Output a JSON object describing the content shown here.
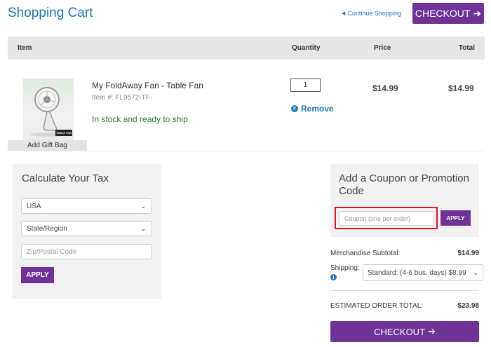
{
  "header": {
    "title": "Shopping Cart",
    "continue_label": "Continue Shopping",
    "checkout_label": "CHECKOUT"
  },
  "table": {
    "columns": [
      "Item",
      "Quantity",
      "Price",
      "Total"
    ]
  },
  "cart_item": {
    "name": "My FoldAway Fan - Table Fan",
    "item_number": "Item #: FL9572-TF",
    "stock_status": "In stock and ready to ship",
    "image_tag": "TABLE FAN",
    "gift_bag_label": "Add Gift Bag",
    "quantity": "1",
    "remove_label": "Remove",
    "price": "$14.99",
    "total": "$14.99"
  },
  "tax": {
    "title": "Calculate Your Tax",
    "country": "USA",
    "region": "State/Region",
    "zip_placeholder": "Zip/Postal Code",
    "apply_label": "APPLY"
  },
  "coupon": {
    "title": "Add a Coupon or Promotion Code",
    "placeholder": "Coupon (one per order)",
    "apply_label": "APPLY"
  },
  "summary": {
    "subtotal_label": "Merchandise Subtotal:",
    "subtotal_value": "$14.99",
    "shipping_label": "Shipping:",
    "shipping_option": "Standard: (4-6 bus. days) $8.99",
    "estimated_label": "ESTIMATED ORDER TOTAL:",
    "estimated_value": "$23.98",
    "checkout_label": "CHECKOUT"
  },
  "colors": {
    "brand_blue": "#1f76b8",
    "brand_purple": "#6f3398",
    "highlight_red": "#e0141b",
    "stock_green": "#2f7d32"
  },
  "icons": {
    "continue": "chevron-left-icon",
    "checkout": "arrow-right-icon",
    "remove": "remove-circle-icon",
    "dropdown": "chevron-down-icon",
    "info": "info-icon"
  }
}
